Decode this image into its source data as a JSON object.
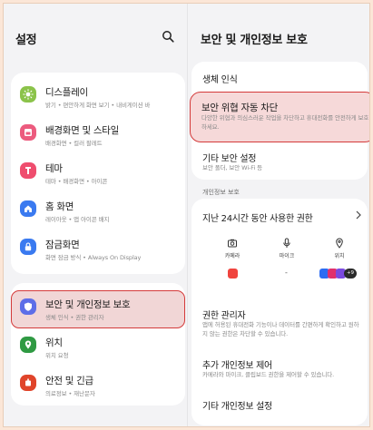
{
  "left": {
    "title": "설정",
    "items": [
      {
        "title": "디스플레이",
        "sub": "밝기 • 편안하게 화면 보기 • 내비게이션 바",
        "icon": "sun-icon",
        "color": "#8bc34a"
      },
      {
        "title": "배경화면 및 스타일",
        "sub": "배경화면 • 컬러 팔레트",
        "icon": "palette-icon",
        "color": "#ec5b7e"
      },
      {
        "title": "테마",
        "sub": "테마 • 배경화면 • 아이콘",
        "icon": "theme-icon",
        "color": "#ef4d6e"
      },
      {
        "title": "홈 화면",
        "sub": "레이아웃 • 앱 아이콘 배지",
        "icon": "home-icon",
        "color": "#3a7af0"
      },
      {
        "title": "잠금화면",
        "sub": "화면 잠금 방식 • Always On Display",
        "icon": "lock-icon",
        "color": "#3a7af0"
      },
      {
        "title": "보안 및 개인정보 보호",
        "sub": "생체 인식 • 권한 관리자",
        "icon": "shield-icon",
        "color": "#5d6ee8"
      },
      {
        "title": "위치",
        "sub": "위치 요청",
        "icon": "location-icon",
        "color": "#2f9a43"
      },
      {
        "title": "안전 및 긴급",
        "sub": "의료정보 • 재난문자",
        "icon": "emergency-icon",
        "color": "#e0442a"
      }
    ]
  },
  "right": {
    "title": "보안 및 개인정보 보호",
    "biometrics": "생체 인식",
    "auto_block": {
      "title": "보안 위협 자동 차단",
      "sub": "다양한 위협과 의심스러운 작업을 차단하고 휴대전화를 안전하게 보호하세요."
    },
    "other_security": {
      "title": "기타 보안 설정",
      "sub": "보안 폴더, 보안 Wi-Fi 등"
    },
    "privacy_label": "개인정보 보호",
    "last24": "지난 24시간 동안 사용한 권한",
    "perms": [
      {
        "label": "카메라",
        "icon": "camera-icon"
      },
      {
        "label": "마이크",
        "icon": "microphone-icon"
      },
      {
        "label": "위치",
        "icon": "location-pin-icon"
      }
    ],
    "mic_dash": "-",
    "more_apps": "+9",
    "perm_manager": {
      "title": "권한 관리자",
      "sub": "앱에 허용된 휴대전화 기능이나 데이터를 간편하게 확인하고 원하지 않는 권한은 차단할 수 있습니다."
    },
    "extra_controls": {
      "title": "추가 개인정보 제어",
      "sub": "카메라와 마이크, 클립보드 권한을 제어할 수 있습니다."
    },
    "other_privacy": "기타 개인정보 설정"
  }
}
